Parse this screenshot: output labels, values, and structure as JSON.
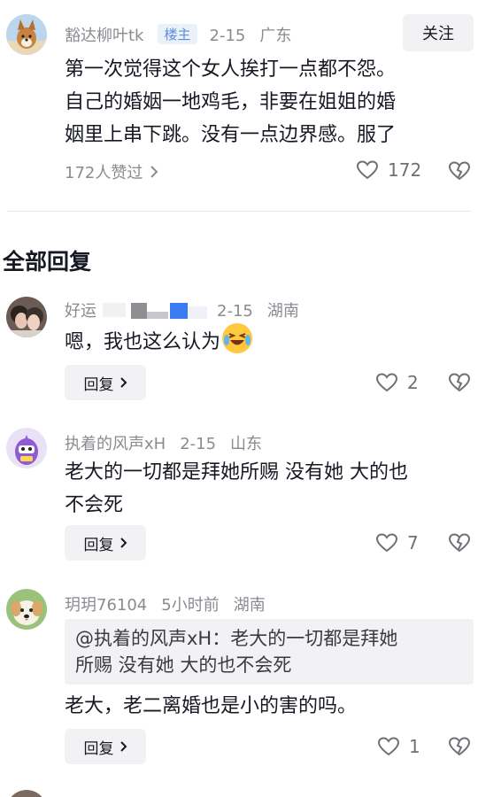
{
  "comment1": {
    "username": "豁达柳叶tk",
    "badge": "楼主",
    "date": "2-15",
    "region": "广东",
    "follow_label": "关注",
    "text_line1": "第一次觉得这个女人挨打一点都不怨。",
    "text_line2": "自己的婚姻一地鸡毛，非要在姐姐的婚",
    "text_line3": "姻里上串下跳。没有一点边界感。服了",
    "likes_summary": "172人赞过",
    "like_count": "172",
    "icons": [
      "chevron-right-icon",
      "heart-icon",
      "broken-heart-icon"
    ]
  },
  "section_title": "全部回复",
  "reply1": {
    "username": "好运",
    "date": "2-15",
    "region": "湖南",
    "text": "嗯，我也这么认为",
    "emoji": "laughing-crying-emoji",
    "reply_label": "回复",
    "like_count": "2"
  },
  "reply2": {
    "username": "执着的风声xH",
    "date": "2-15",
    "region": "山东",
    "text_line1": "老大的一切都是拜她所赐 没有她 大的也",
    "text_line2": "不会死",
    "reply_label": "回复",
    "like_count": "7"
  },
  "reply3": {
    "username": "玥玥76104",
    "date": "5小时前",
    "region": "湖南",
    "quote_line1": "@执着的风声xH：老大的一切都是拜她",
    "quote_line2": "所赐 没有她 大的也不会死",
    "text": "老大，老二离婚也是小的害的吗。",
    "reply_label": "回复",
    "like_count": "1"
  },
  "colors": {
    "text_primary": "#161823",
    "text_secondary": "#8a8b91",
    "button_bg": "#f2f2f4",
    "badge_bg": "#eaf1fb",
    "badge_text": "#5b8fd9"
  }
}
